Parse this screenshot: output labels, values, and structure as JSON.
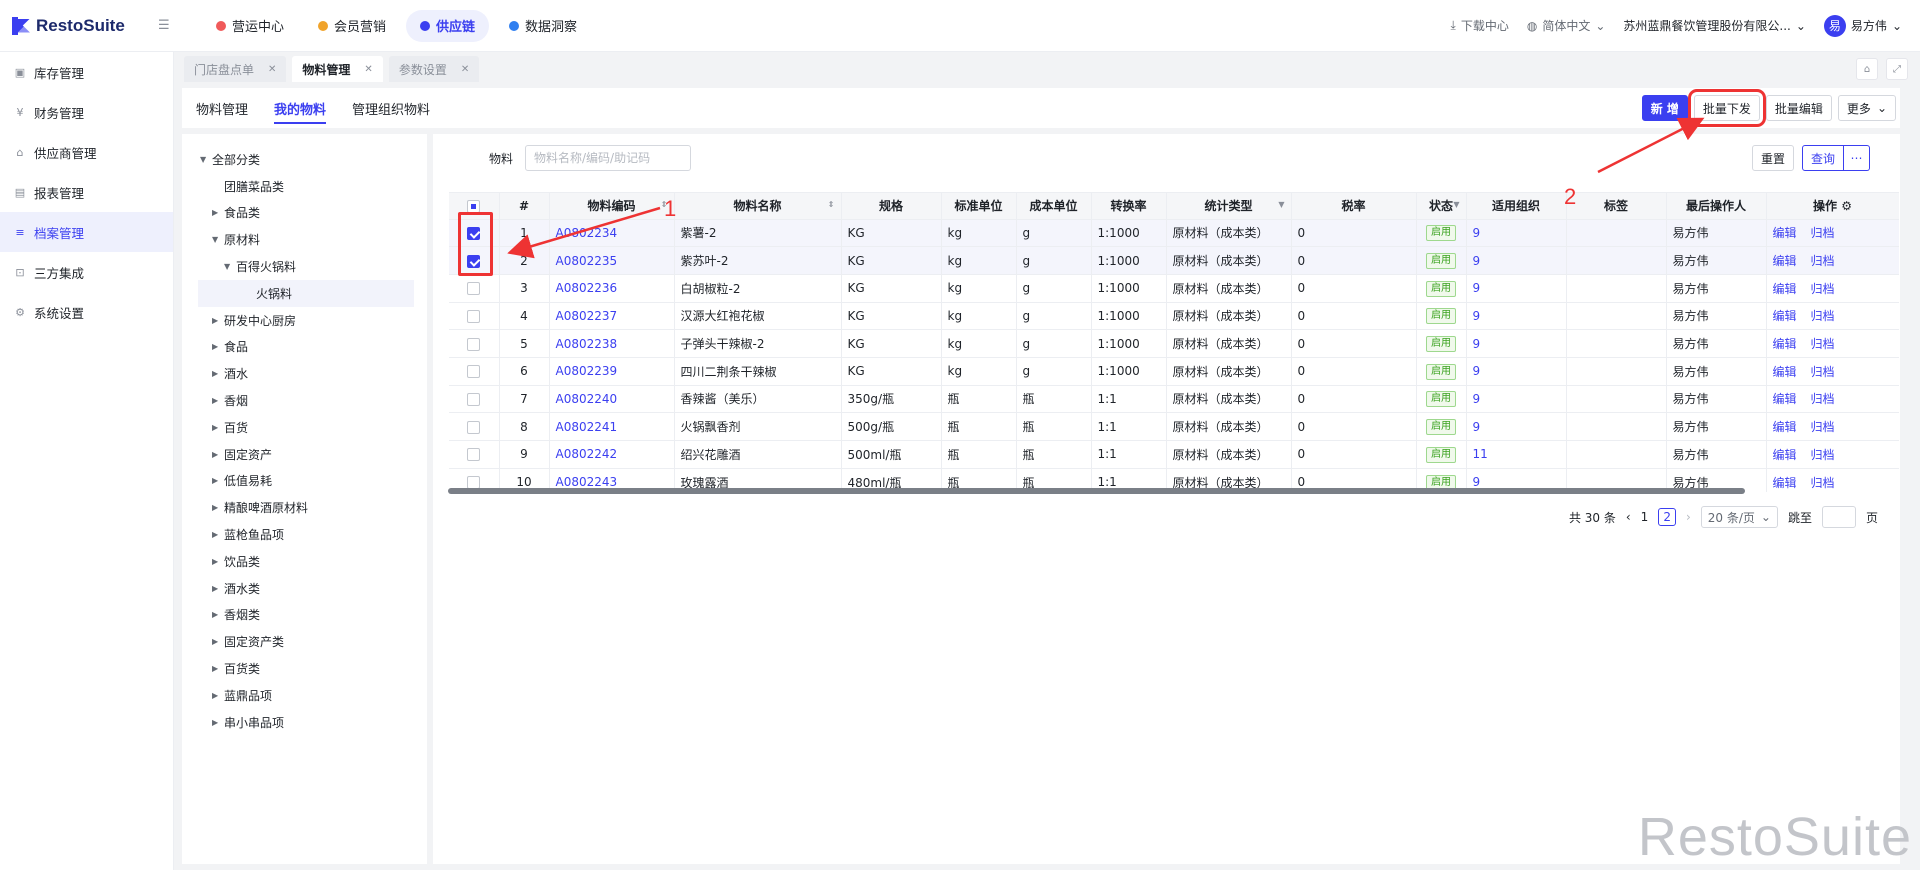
{
  "app": {
    "logo_text": "RestoSuite"
  },
  "topnav": [
    {
      "label": "营运中心",
      "color": "#f05a5a"
    },
    {
      "label": "会员营销",
      "color": "#f0a32b"
    },
    {
      "label": "供应链",
      "color": "#3b3ff0"
    },
    {
      "label": "数据洞察",
      "color": "#2f7ff0"
    }
  ],
  "topright": {
    "download": "下载中心",
    "lang": "简体中文",
    "company": "苏州蓝鼎餐饮管理股份有限公...",
    "avatar_char": "易",
    "user": "易方伟"
  },
  "sidebar": [
    {
      "label": "库存管理",
      "icon": "box-icon"
    },
    {
      "label": "财务管理",
      "icon": "finance-icon"
    },
    {
      "label": "供应商管理",
      "icon": "supplier-icon"
    },
    {
      "label": "报表管理",
      "icon": "report-icon"
    },
    {
      "label": "档案管理",
      "icon": "archive-icon"
    },
    {
      "label": "三方集成",
      "icon": "integration-icon"
    },
    {
      "label": "系统设置",
      "icon": "gear-icon"
    }
  ],
  "tabs": [
    {
      "label": "门店盘点单"
    },
    {
      "label": "物料管理"
    },
    {
      "label": "参数设置"
    }
  ],
  "subtabs": [
    "物料管理",
    "我的物料",
    "管理组织物料"
  ],
  "actions": {
    "add": "新 增",
    "batch_issue": "批量下发",
    "batch_edit": "批量编辑",
    "more": "更多"
  },
  "tree": {
    "root": "全部分类",
    "items": [
      {
        "label": "团膳菜品类",
        "level": 1,
        "caret": ""
      },
      {
        "label": "食品类",
        "level": 1,
        "caret": "▶"
      },
      {
        "label": "原材料",
        "level": 1,
        "caret": "▼"
      },
      {
        "label": "百得火锅料",
        "level": 2,
        "caret": "▼"
      },
      {
        "label": "火锅料",
        "level": 3,
        "caret": ""
      },
      {
        "label": "研发中心厨房",
        "level": 1,
        "caret": "▶"
      },
      {
        "label": "食品",
        "level": 1,
        "caret": "▶"
      },
      {
        "label": "酒水",
        "level": 1,
        "caret": "▶"
      },
      {
        "label": "香烟",
        "level": 1,
        "caret": "▶"
      },
      {
        "label": "百货",
        "level": 1,
        "caret": "▶"
      },
      {
        "label": "固定资产",
        "level": 1,
        "caret": "▶"
      },
      {
        "label": "低值易耗",
        "level": 1,
        "caret": "▶"
      },
      {
        "label": "精酿啤酒原材料",
        "level": 1,
        "caret": "▶"
      },
      {
        "label": "蓝枪鱼品项",
        "level": 1,
        "caret": "▶"
      },
      {
        "label": "饮品类",
        "level": 1,
        "caret": "▶"
      },
      {
        "label": "酒水类",
        "level": 1,
        "caret": "▶"
      },
      {
        "label": "香烟类",
        "level": 1,
        "caret": "▶"
      },
      {
        "label": "固定资产类",
        "level": 1,
        "caret": "▶"
      },
      {
        "label": "百货类",
        "level": 1,
        "caret": "▶"
      },
      {
        "label": "蓝鼎品项",
        "level": 1,
        "caret": "▶"
      },
      {
        "label": "串小串品项",
        "level": 1,
        "caret": "▶"
      }
    ]
  },
  "filter": {
    "label": "物料",
    "placeholder": "物料名称/编码/助记码",
    "reset": "重置",
    "query": "查询"
  },
  "table": {
    "headers": [
      "#",
      "物料编码",
      "物料名称",
      "规格",
      "标准单位",
      "成本单位",
      "转换率",
      "统计类型",
      "税率",
      "状态",
      "适用组织",
      "标签",
      "最后操作人",
      "操作"
    ],
    "rows": [
      {
        "n": "1",
        "code": "A0802234",
        "name": "紫薯-2",
        "spec": "KG",
        "std": "kg",
        "cost": "g",
        "rate": "1:1000",
        "type": "原材料（成本类）",
        "tax": "0",
        "status": "启用",
        "org": "9",
        "tag": "",
        "user": "易方伟",
        "checked": true
      },
      {
        "n": "2",
        "code": "A0802235",
        "name": "紫苏叶-2",
        "spec": "KG",
        "std": "kg",
        "cost": "g",
        "rate": "1:1000",
        "type": "原材料（成本类）",
        "tax": "0",
        "status": "启用",
        "org": "9",
        "tag": "",
        "user": "易方伟",
        "checked": true
      },
      {
        "n": "3",
        "code": "A0802236",
        "name": "白胡椒粒-2",
        "spec": "KG",
        "std": "kg",
        "cost": "g",
        "rate": "1:1000",
        "type": "原材料（成本类）",
        "tax": "0",
        "status": "启用",
        "org": "9",
        "tag": "",
        "user": "易方伟",
        "checked": false
      },
      {
        "n": "4",
        "code": "A0802237",
        "name": "汉源大红袍花椒",
        "spec": "KG",
        "std": "kg",
        "cost": "g",
        "rate": "1:1000",
        "type": "原材料（成本类）",
        "tax": "0",
        "status": "启用",
        "org": "9",
        "tag": "",
        "user": "易方伟",
        "checked": false
      },
      {
        "n": "5",
        "code": "A0802238",
        "name": "子弹头干辣椒-2",
        "spec": "KG",
        "std": "kg",
        "cost": "g",
        "rate": "1:1000",
        "type": "原材料（成本类）",
        "tax": "0",
        "status": "启用",
        "org": "9",
        "tag": "",
        "user": "易方伟",
        "checked": false
      },
      {
        "n": "6",
        "code": "A0802239",
        "name": "四川二荆条干辣椒",
        "spec": "KG",
        "std": "kg",
        "cost": "g",
        "rate": "1:1000",
        "type": "原材料（成本类）",
        "tax": "0",
        "status": "启用",
        "org": "9",
        "tag": "",
        "user": "易方伟",
        "checked": false
      },
      {
        "n": "7",
        "code": "A0802240",
        "name": "香辣酱（美乐）",
        "spec": "350g/瓶",
        "std": "瓶",
        "cost": "瓶",
        "rate": "1:1",
        "type": "原材料（成本类）",
        "tax": "0",
        "status": "启用",
        "org": "9",
        "tag": "",
        "user": "易方伟",
        "checked": false
      },
      {
        "n": "8",
        "code": "A0802241",
        "name": "火锅飘香剂",
        "spec": "500g/瓶",
        "std": "瓶",
        "cost": "瓶",
        "rate": "1:1",
        "type": "原材料（成本类）",
        "tax": "0",
        "status": "启用",
        "org": "9",
        "tag": "",
        "user": "易方伟",
        "checked": false
      },
      {
        "n": "9",
        "code": "A0802242",
        "name": "绍兴花雕酒",
        "spec": "500ml/瓶",
        "std": "瓶",
        "cost": "瓶",
        "rate": "1:1",
        "type": "原材料（成本类）",
        "tax": "0",
        "status": "启用",
        "org": "11",
        "tag": "",
        "user": "易方伟",
        "checked": false
      },
      {
        "n": "10",
        "code": "A0802243",
        "name": "玫瑰露酒",
        "spec": "480ml/瓶",
        "std": "瓶",
        "cost": "瓶",
        "rate": "1:1",
        "type": "原材料（成本类）",
        "tax": "0",
        "status": "启用",
        "org": "9",
        "tag": "",
        "user": "易方伟",
        "checked": false
      }
    ],
    "op_edit": "编辑",
    "op_archive": "归档"
  },
  "pager": {
    "total": "共 30 条",
    "page1": "1",
    "page2": "2",
    "size": "20 条/页",
    "jump_label": "跳至",
    "page_unit": "页"
  },
  "annotations": {
    "n1": "1",
    "n2": "2"
  },
  "watermark": "RestoSuite"
}
